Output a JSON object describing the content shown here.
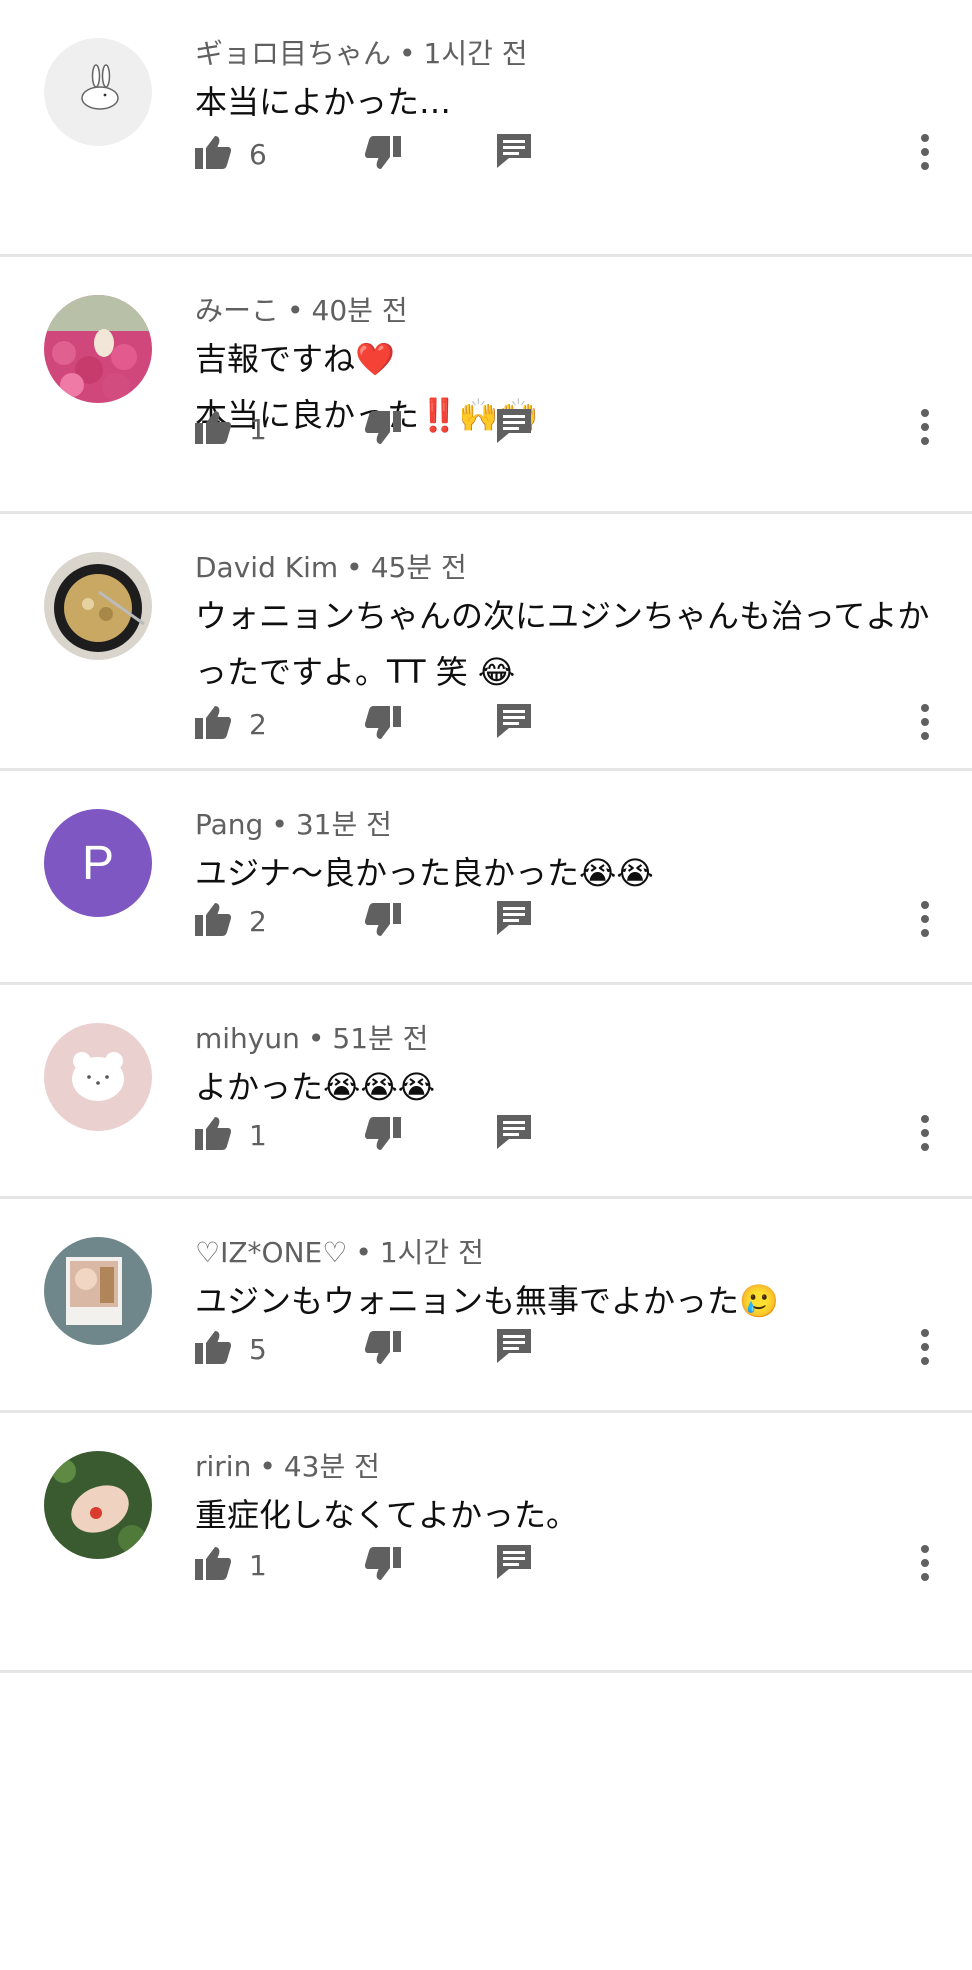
{
  "comments": [
    {
      "author": "ギョロ目ちゃん",
      "time": "1시간 전",
      "text": "本当によかった…",
      "likes": "6",
      "avatar": "rabbit"
    },
    {
      "author": "みーこ",
      "time": "40분 전",
      "text": "吉報ですね❤️\n本当に良かった‼️🙌🙌",
      "likes": "1",
      "avatar": "flowers"
    },
    {
      "author": "David Kim",
      "time": "45분 전",
      "text": "ウォニョンちゃんの次にユジンちゃんも治ってよかったですよ。TT 笑 😂",
      "likes": "2",
      "avatar": "soup"
    },
    {
      "author": "Pang",
      "time": "31분 전",
      "text": "ユジナ〜良かった良かった😭😭",
      "likes": "2",
      "avatar": "letter",
      "avatar_letter": "P",
      "avatar_color": "#7e57c2"
    },
    {
      "author": "mihyun",
      "time": "51분 전",
      "text": "よかった😭😭😭",
      "likes": "1",
      "avatar": "bear"
    },
    {
      "author": "♡IZ*ONE♡",
      "time": "1시간 전",
      "text": "ユジンもウォニョンも無事でよかった🥲",
      "likes": "5",
      "avatar": "photo"
    },
    {
      "author": "ririn",
      "time": "43분 전",
      "text": "重症化しなくてよかった。",
      "likes": "1",
      "avatar": "hand"
    }
  ],
  "colors": {
    "icon": "#606060",
    "divider": "#e5e5e5",
    "meta": "#606060"
  }
}
